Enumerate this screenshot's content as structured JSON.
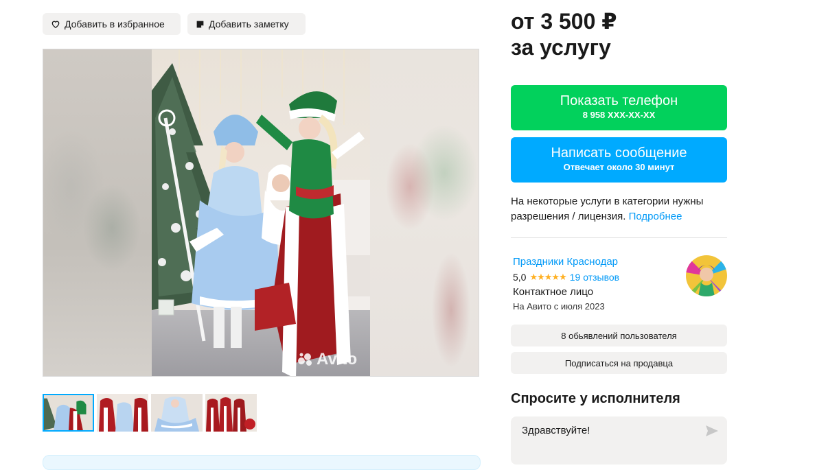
{
  "actions": {
    "favorite_label": "Добавить в избранное",
    "note_label": "Добавить заметку"
  },
  "gallery": {
    "watermark": "Avito",
    "thumbnail_count": 4,
    "active_thumbnail": 1
  },
  "price": {
    "line1": "от 3 500 ₽",
    "line2": "за услугу"
  },
  "contact": {
    "phone_button_label": "Показать телефон",
    "phone_masked": "8 958 XXX-XX-XX",
    "message_button_label": "Написать сообщение",
    "message_reply_time": "Отвечает около 30 минут"
  },
  "license_notice": {
    "text": "На некоторые услуги в категории нужны разрешения / лицензия.",
    "link": "Подробнее"
  },
  "seller": {
    "name": "Праздники Краснодар",
    "rating": "5,0",
    "stars": "★★★★★",
    "reviews": "19 отзывов",
    "role": "Контактное лицо",
    "since": "На Авито с июля 2023",
    "ads_button": "8 обьявлений пользователя",
    "subscribe_button": "Подписаться на продавца"
  },
  "ask": {
    "title": "Спросите у исполнителя",
    "message_value": "Здравствуйте!"
  },
  "colors": {
    "green": "#02d15c",
    "blue": "#00aaff",
    "link": "#0099f7",
    "star": "#ffb021",
    "grey_button": "#f2f1f0"
  }
}
